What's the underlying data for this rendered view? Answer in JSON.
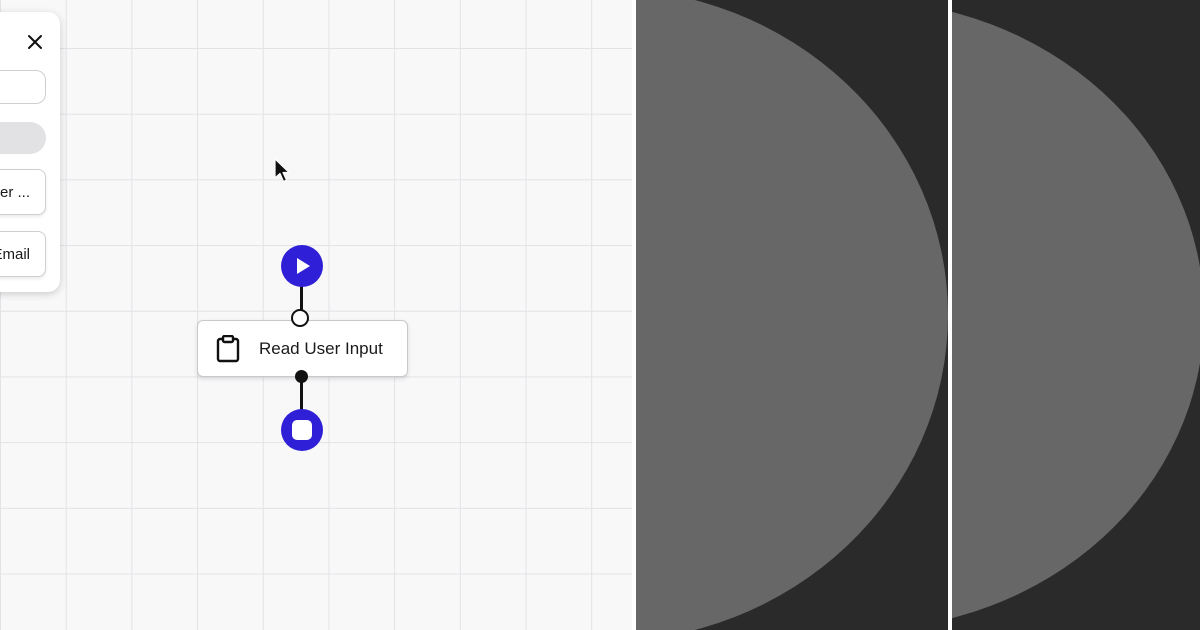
{
  "palette": {
    "close_icon": "close-icon",
    "search_value": "",
    "items": [
      {
        "label": "User ..."
      },
      {
        "label": "Email"
      }
    ]
  },
  "flow": {
    "start_icon": "play-icon",
    "end_icon": "stop-icon",
    "task": {
      "icon": "clipboard-icon",
      "label": "Read User Input"
    }
  },
  "colors": {
    "accent": "#2f1fd6",
    "canvas_bg": "#f8f8f9",
    "grid_line": "#e3e3e6",
    "dark_panel": "#2a2a2a",
    "disc": "#676767"
  }
}
